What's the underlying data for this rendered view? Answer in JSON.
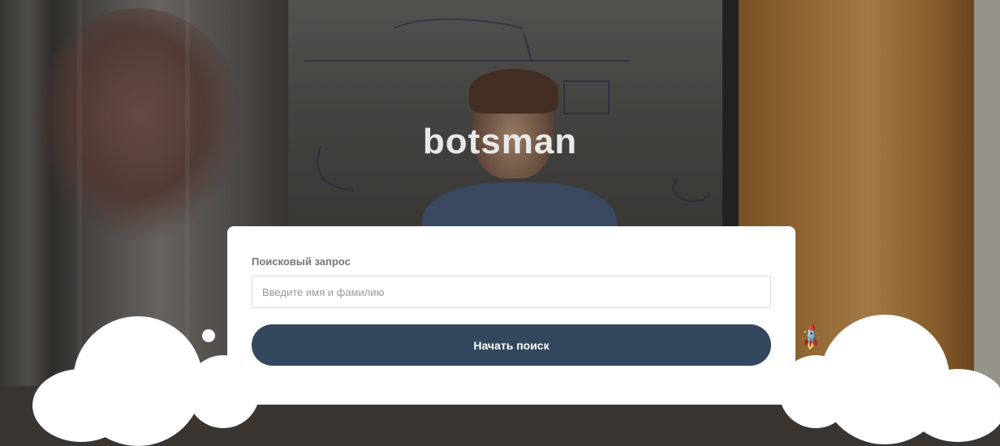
{
  "brand": {
    "name": "botsman"
  },
  "search": {
    "label": "Поисковый запрос",
    "placeholder": "Введите имя и фамилию",
    "value": "",
    "button_label": "Начать поиск"
  },
  "icons": {
    "decor_dot": "circle",
    "rocket": "rocket-icon"
  },
  "colors": {
    "button": "#33485e",
    "card": "#ffffff",
    "brand_text": "#e8e8e8"
  }
}
